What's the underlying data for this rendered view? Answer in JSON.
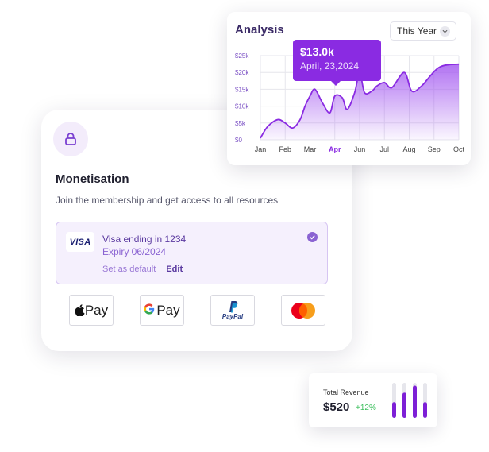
{
  "monetisation": {
    "title": "Monetisation",
    "subtitle": "Join the membership and get access to all resources",
    "card": {
      "brand": "VISA",
      "ending": "Visa ending in 1234",
      "expiry": "Expiry 06/2024",
      "set_default": "Set as default",
      "edit": "Edit"
    },
    "payment_methods": [
      {
        "name": "apple-pay",
        "label": "Pay"
      },
      {
        "name": "google-pay",
        "label": "Pay"
      },
      {
        "name": "paypal",
        "label": "PayPal"
      },
      {
        "name": "mastercard",
        "label": ""
      }
    ]
  },
  "analysis": {
    "title": "Analysis",
    "period_select": "This Year",
    "tooltip": {
      "value": "$13.0k",
      "date": "April, 23,2024"
    }
  },
  "chart_data": {
    "type": "area",
    "x": [
      "Jan",
      "Feb",
      "Mar",
      "Apr",
      "Jun",
      "Jul",
      "Aug",
      "Sep",
      "Oct"
    ],
    "highlighted_x": "Apr",
    "ytick_labels": [
      "$0",
      "$5k",
      "$10k",
      "$15k",
      "$20k",
      "$25k"
    ],
    "ylim": [
      0,
      25000
    ],
    "grid": true,
    "points": [
      [
        0.0,
        500
      ],
      [
        0.3,
        4000
      ],
      [
        0.7,
        6000
      ],
      [
        1.0,
        5000
      ],
      [
        1.3,
        3500
      ],
      [
        1.6,
        6000
      ],
      [
        1.8,
        10000
      ],
      [
        2.0,
        13000
      ],
      [
        2.2,
        15000
      ],
      [
        2.5,
        11000
      ],
      [
        2.8,
        8000
      ],
      [
        3.0,
        13000
      ],
      [
        3.3,
        12500
      ],
      [
        3.5,
        9000
      ],
      [
        3.8,
        14000
      ],
      [
        4.0,
        20000
      ],
      [
        4.2,
        14000
      ],
      [
        4.5,
        14500
      ],
      [
        4.7,
        16000
      ],
      [
        5.0,
        17000
      ],
      [
        5.3,
        15500
      ],
      [
        5.8,
        20000
      ],
      [
        6.1,
        14500
      ],
      [
        6.5,
        16000
      ],
      [
        7.2,
        21500
      ],
      [
        8.0,
        22500
      ]
    ],
    "line_color": "#8a2be2",
    "fill_color": "#a45af0"
  },
  "revenue": {
    "label": "Total Revenue",
    "value": "$520",
    "change": "+12%",
    "bars": [
      0.45,
      0.72,
      0.92,
      0.45
    ],
    "bar_color": "#7d1fd6",
    "track_color": "#e6e6ec"
  }
}
